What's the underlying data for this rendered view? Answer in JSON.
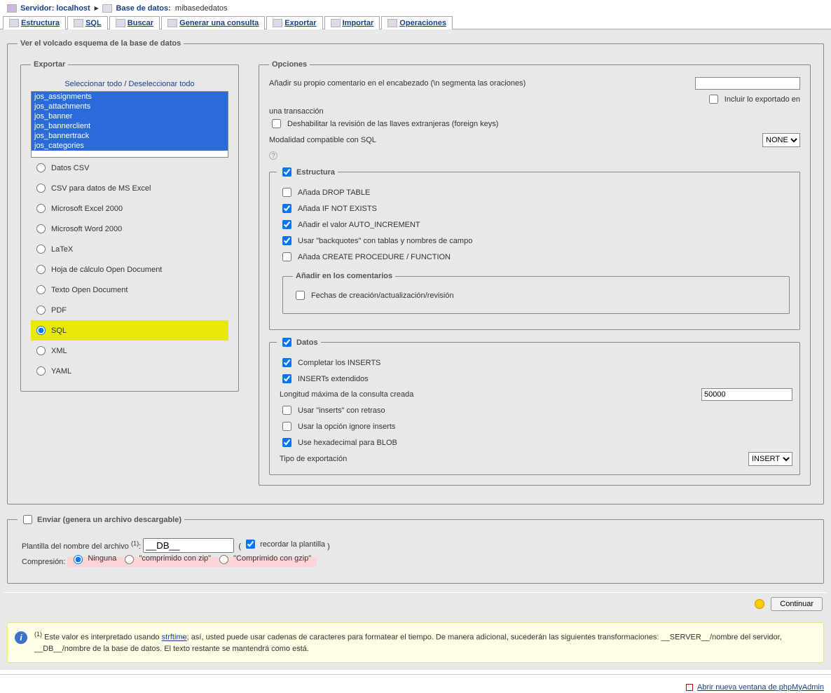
{
  "breadcrumb": {
    "server_label": "Servidor:",
    "server_value": "localhost",
    "db_label": "Base de datos:",
    "db_value": "mibasededatos"
  },
  "tabs": {
    "structure": "Estructura",
    "sql": "SQL",
    "search": "Buscar",
    "query": "Generar una consulta",
    "export": "Exportar",
    "import": "Importar",
    "operations": "Operaciones"
  },
  "main_fieldset": "Ver el volcado esquema de la base de datos",
  "export": {
    "legend": "Exportar",
    "select_all": "Seleccionar todo",
    "deselect_all": "Deseleccionar todo",
    "tables": [
      "jos_assignments",
      "jos_attachments",
      "jos_banner",
      "jos_bannerclient",
      "jos_bannertrack",
      "jos_categories"
    ],
    "formats": {
      "csv": "Datos CSV",
      "csv_excel": "CSV para datos de MS Excel",
      "excel2000": "Microsoft Excel 2000",
      "word2000": "Microsoft Word 2000",
      "latex": "LaTeX",
      "ods": "Hoja de cálculo Open Document",
      "odt": "Texto Open Document",
      "pdf": "PDF",
      "sql": "SQL",
      "xml": "XML",
      "yaml": "YAML"
    }
  },
  "options": {
    "legend": "Opciones",
    "comment_label": "Añadir su propio comentario en el encabezado (\\n segmenta las oraciones)",
    "include_export": "Incluir lo exportado en",
    "transaction": "una transacción",
    "disable_fk": "Deshabilitar la revisión de las llaves extranjeras (foreign keys)",
    "compat_label": "Modalidad compatible con SQL",
    "compat_value": "NONE",
    "structure": {
      "legend": "Estructura",
      "drop": "Añada DROP TABLE",
      "ifnotexists": "Añada IF NOT EXISTS",
      "autoinc": "Añadir el valor AUTO_INCREMENT",
      "backquotes": "Usar \"backquotes\" con tablas y nombres de campo",
      "procedure": "Añada CREATE PROCEDURE / FUNCTION",
      "comments_legend": "Añadir en los comentarios",
      "dates": "Fechas de creación/actualización/revisión"
    },
    "data": {
      "legend": "Datos",
      "complete": "Completar los INSERTS",
      "extended": "INSERTs extendidos",
      "maxlen_label": "Longitud máxima de la consulta creada",
      "maxlen_value": "50000",
      "delayed": "Usar \"inserts\" con retraso",
      "ignore": "Usar la opción ignore inserts",
      "hexblob": "Use hexadecimal para BLOB",
      "type_label": "Tipo de exportación",
      "type_value": "INSERT"
    }
  },
  "send": {
    "legend": "Enviar (genera un archivo descargable)",
    "filename_label_pre": "Plantilla del nombre del archivo",
    "filename_sup": "(1)",
    "filename_value": "__DB__",
    "remember": "recordar la plantilla",
    "compression_label": "Compresión:",
    "none": "Ninguna",
    "zip": "\"comprimido con zip\"",
    "gzip": "\"Comprimido con gzip\""
  },
  "continue_btn": "Continuar",
  "notice": {
    "sup": "(1)",
    "pre": "Este valor es interpretado usando ",
    "link": "strftime",
    "post": "; así, usted puede usar cadenas de caracteres para formatear el tiempo. De manera adicional, sucederán las siguientes transformaciones: __SERVER__/nombre del servidor, __DB__/nombre de la base de datos. El texto restante se mantendrá como está."
  },
  "bottom_link": "Abrir nueva ventana de phpMyAdmin"
}
